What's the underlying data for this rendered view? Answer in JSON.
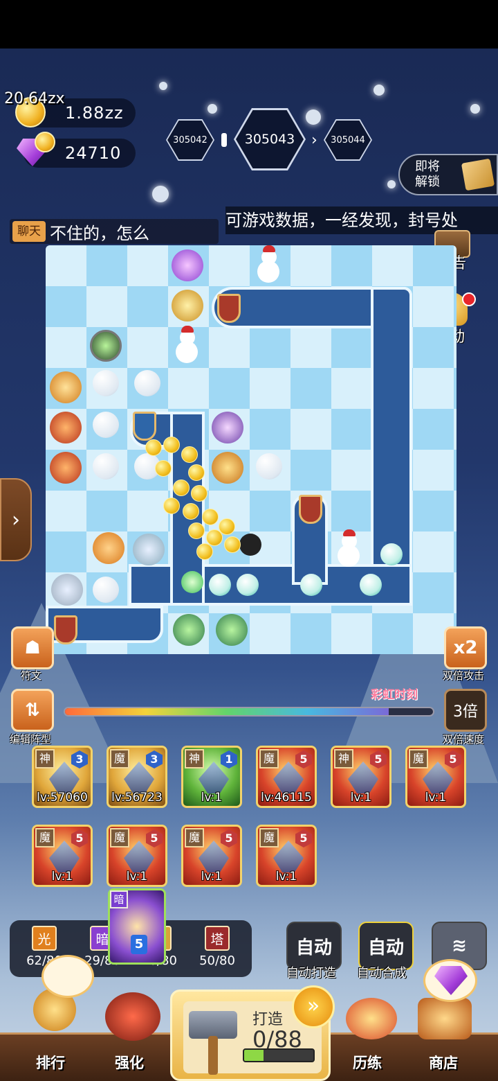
{
  "top": {
    "gold_main": "20.64zx",
    "gold_small": "1.88zz",
    "gems": "24710"
  },
  "stages": {
    "prev": "305042",
    "current": "305043",
    "next": "305044"
  },
  "unlock": {
    "label": "即将\n解锁"
  },
  "marquee": "可游戏数据，一经发现，封号处",
  "chat": {
    "tag": "聊天",
    "text": "不住的，怎么"
  },
  "side_buttons": {
    "notice": "公告",
    "activity": "活动",
    "rune": "符文",
    "double_attack": "双倍攻击",
    "edit_formation": "编辑阵型",
    "double_speed": "双倍速度",
    "speed_value": "3倍",
    "rainbow": "彩虹时刻"
  },
  "rainbow_progress": 0.88,
  "cards": [
    {
      "tag": "神",
      "rank": "3",
      "rank_color": "blue",
      "level": "lv:57060",
      "style": "gold"
    },
    {
      "tag": "魔",
      "rank": "3",
      "rank_color": "blue",
      "level": "lv:56723",
      "style": "gold"
    },
    {
      "tag": "神",
      "rank": "1",
      "rank_color": "blue",
      "level": "lv:1",
      "style": "green"
    },
    {
      "tag": "魔",
      "rank": "5",
      "rank_color": "red",
      "level": "lv:46115",
      "style": "red"
    },
    {
      "tag": "神",
      "rank": "5",
      "rank_color": "red",
      "level": "lv:1",
      "style": "red"
    },
    {
      "tag": "魔",
      "rank": "5",
      "rank_color": "red",
      "level": "lv:1",
      "style": "red"
    },
    {
      "tag": "魔",
      "rank": "5",
      "rank_color": "red",
      "level": "lv:1",
      "style": "red"
    },
    {
      "tag": "魔",
      "rank": "5",
      "rank_color": "red",
      "level": "lv:1",
      "style": "red"
    },
    {
      "tag": "魔",
      "rank": "5",
      "rank_color": "red",
      "level": "lv:1",
      "style": "red"
    },
    {
      "tag": "魔",
      "rank": "5",
      "rank_color": "red",
      "level": "lv:1",
      "style": "red"
    }
  ],
  "dark_card": {
    "tag": "暗",
    "count": "5"
  },
  "elements": [
    {
      "label": "光",
      "count": "62/80",
      "color": "#e0801e"
    },
    {
      "label": "暗",
      "count": "29/80",
      "color": "#8a3fd0"
    },
    {
      "label": "",
      "count": "10/80",
      "color": "#d9a43a"
    },
    {
      "label": "塔",
      "count": "50/80",
      "color": "#9b2b2b"
    }
  ],
  "auto": {
    "forge_btn": "自动",
    "forge_label": "自动打造",
    "merge_btn": "自动",
    "merge_label": "自动合成"
  },
  "forge": {
    "title": "打造",
    "count": "0/88",
    "progress": 0.28
  },
  "nav": {
    "rank": "排行",
    "upgrade": "强化",
    "train": "历练",
    "shop": "商店"
  },
  "colors": {
    "path": "#2d5b9a",
    "accent": "#f3a25a"
  }
}
